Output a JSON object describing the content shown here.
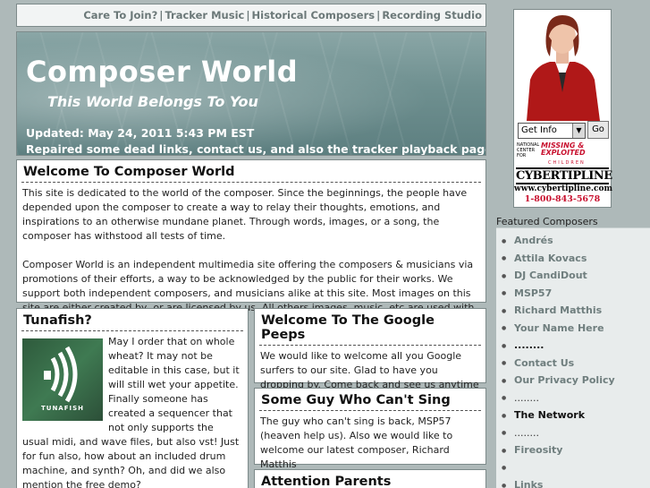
{
  "nav": {
    "items": [
      "Care To Join?",
      "Tracker Music",
      "Historical Composers",
      "Recording Studio"
    ],
    "separator": "|"
  },
  "header": {
    "title": "Composer World",
    "tagline": "This World Belongs To You",
    "updated": "Updated: May 24, 2011 5:43 PM EST",
    "notice": "Repaired some dead links, contact us, and also the tracker playback pages."
  },
  "welcome": {
    "heading": "Welcome To Composer World",
    "para1": "This site is dedicated to the world of the composer. Since the beginnings, the people have depended upon the composer to create a way to relay their thoughts, emotions, and inspirations to an otherwise mundane planet. Through words, images, or a song, the composer has withstood all tests of time.",
    "para2": "Composer World is an independent multimedia site offering the composers & musicians via promotions of their efforts, a way to be acknowledged by the public for their works. We support both independent composers, and musicians alike at this site. Most images on this site are either created by, or are licensed by us. All others images, music, etc are used with the permission of the artist."
  },
  "tunafish": {
    "heading": "Tunafish?",
    "logo_text": "TUNAFISH",
    "body": "May I order that on whole wheat? It may not be editable in this case, but it will still wet your appetite. Finally someone has created a sequencer that not only supports the usual midi, and wave files, but also vst! Just for fun also, how about an included drum machine, and synth? Oh, and did we also mention the free demo?"
  },
  "google": {
    "heading": "Welcome To The Google Peeps",
    "body": "We would like to welcome all you Google surfers to our site. Glad to have you dropping by. Come back and see us anytime :o)"
  },
  "someguy": {
    "heading": "Some Guy Who Can't Sing",
    "body": "The guy who can't sing is back, MSP57 (heaven help us). Also we would like to welcome our latest composer, Richard Matthis"
  },
  "attention": {
    "heading": "Attention Parents"
  },
  "ad": {
    "select_value": "Get Info",
    "go_label": "Go",
    "small_logo": "NATIONAL CENTER FOR",
    "missing": "MISSING & EXPLOITED",
    "children": "CHILDREN",
    "brand": "CYBERTIPLINE",
    "url": "www.cybertipline.com",
    "phone": "1-800-843-5678"
  },
  "sidebar": {
    "title": "Featured Composers",
    "items": [
      {
        "label": "Andrés",
        "type": "link"
      },
      {
        "label": "Attila Kovacs",
        "type": "link"
      },
      {
        "label": "DJ CandiDout",
        "type": "link"
      },
      {
        "label": "MSP57",
        "type": "link"
      },
      {
        "label": "Richard Matthis",
        "type": "link"
      },
      {
        "label": "Your Name Here",
        "type": "link"
      },
      {
        "label": "........",
        "type": "dots-bold"
      },
      {
        "label": "Contact Us",
        "type": "link"
      },
      {
        "label": "Our Privacy Policy",
        "type": "link"
      },
      {
        "label": "........",
        "type": "dots"
      },
      {
        "label": "The Network",
        "type": "dark"
      },
      {
        "label": "........",
        "type": "dots"
      },
      {
        "label": "Fireosity",
        "type": "link"
      },
      {
        "label": "",
        "type": "dots"
      },
      {
        "label": "Links",
        "type": "link"
      }
    ]
  },
  "colors": {
    "background": "#aeb9b9",
    "nav_text": "#6b7878",
    "sidebar_link": "#6f7e7e",
    "ad_red": "#c8102e"
  }
}
